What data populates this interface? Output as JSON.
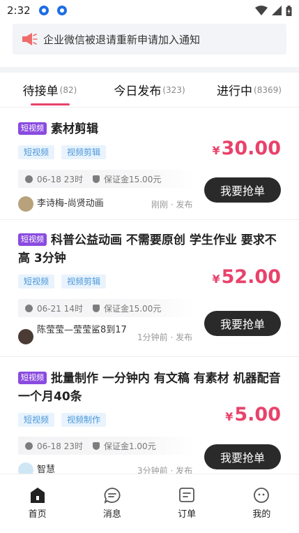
{
  "status": {
    "time": "2:32"
  },
  "notice": {
    "text": "企业微信被退请重新申请加入通知"
  },
  "tabs": [
    {
      "label": "待接单",
      "count": "(82)"
    },
    {
      "label": "今日发布",
      "count": "(323)"
    },
    {
      "label": "进行中",
      "count": "(8369)"
    }
  ],
  "tasks": [
    {
      "badge": "短视频",
      "title": "素材剪辑",
      "tags": [
        "短视频",
        "视频剪辑"
      ],
      "currency": "¥",
      "price": "30.00",
      "deadline": "06-18 23时",
      "deposit": "保证金15.00元",
      "button": "我要抢单",
      "publisher": "李诗梅-尚贤动画",
      "posted": "刚刚 · 发布"
    },
    {
      "badge": "短视频",
      "title": "科普公益动画 不需要原创 学生作业 要求不高 3分钟",
      "tags": [
        "短视频",
        "视频剪辑"
      ],
      "currency": "¥",
      "price": "52.00",
      "deadline": "06-21 14时",
      "deposit": "保证金15.00元",
      "button": "我要抢单",
      "publisher": "陈莹莹—莹莹鲨8到17",
      "posted": "1分钟前 · 发布"
    },
    {
      "badge": "短视频",
      "title": "批量制作 一分钟内 有文稿 有素材 机器配音 一个月40条",
      "tags": [
        "短视频",
        "视频制作"
      ],
      "currency": "¥",
      "price": "5.00",
      "deadline": "06-18 23时",
      "deposit": "保证金1.00元",
      "button": "我要抢单",
      "publisher": "智慧",
      "posted": "3分钟前 · 发布"
    }
  ],
  "nav": [
    {
      "label": "首页"
    },
    {
      "label": "消息"
    },
    {
      "label": "订单"
    },
    {
      "label": "我的"
    }
  ],
  "colors": {
    "accent": "#e8426b",
    "badge": "#8a4be0",
    "tag_bg": "#e8f3fd",
    "tag_text": "#4a97d8",
    "button": "#2a2a2a"
  }
}
